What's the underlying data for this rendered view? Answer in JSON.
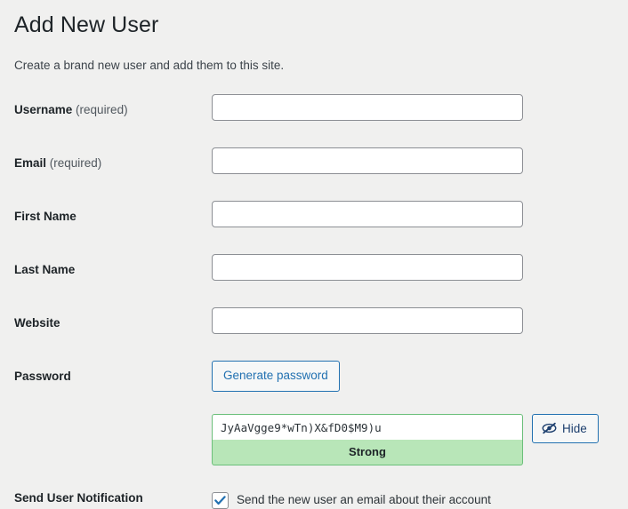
{
  "header": {
    "title": "Add New User",
    "subtitle": "Create a brand new user and add them to this site."
  },
  "form": {
    "fields": [
      {
        "label": "Username",
        "required_suffix": " (required)",
        "value": "",
        "placeholder": ""
      },
      {
        "label": "Email",
        "required_suffix": " (required)",
        "value": "",
        "placeholder": ""
      },
      {
        "label": "First Name",
        "required_suffix": "",
        "value": "",
        "placeholder": ""
      },
      {
        "label": "Last Name",
        "required_suffix": "",
        "value": "",
        "placeholder": ""
      },
      {
        "label": "Website",
        "required_suffix": "",
        "value": "",
        "placeholder": ""
      }
    ],
    "password": {
      "label": "Password",
      "generate_button_label": "Generate password",
      "value": "JyAaVgge9*wTn)X&fD0$M9)u",
      "hide_button_label": "Hide",
      "hide_button_icon": "eye-slash-icon",
      "strength_label": "Strong",
      "strength_color": "#b8e6b8",
      "border_color": "#6bbf7a"
    },
    "notification": {
      "label": "Send User Notification",
      "checkbox_label": "Send the new user an email about their account",
      "checked": true,
      "check_color": "#2271b1"
    }
  },
  "theme": {
    "background": "#f0f0ef",
    "text": "#1d2327",
    "muted_text": "#50575e",
    "accent": "#2271b1",
    "input_border": "#8c8f94"
  }
}
